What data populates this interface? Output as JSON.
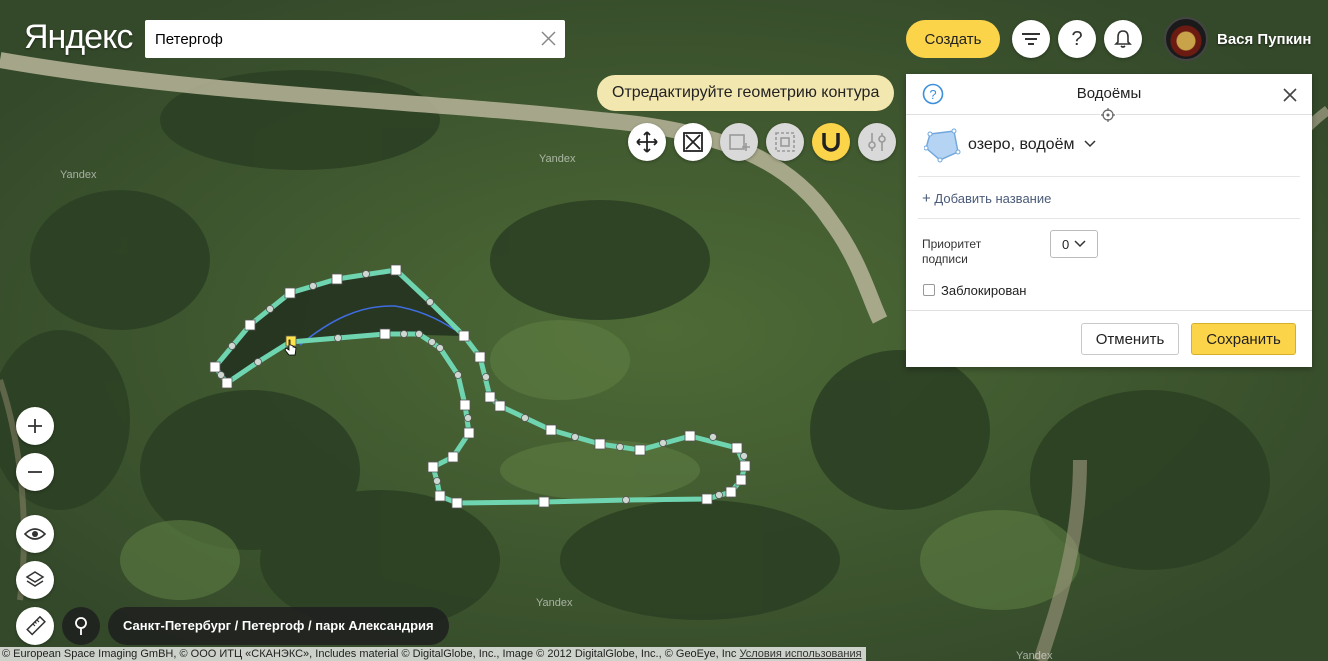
{
  "header": {
    "logo": "Яндекс",
    "search_value": "Петергоф",
    "create_label": "Создать",
    "user_name": "Вася Пупкин"
  },
  "icons": {
    "filter": "filter-icon",
    "help": "question-icon",
    "notifications": "bell-icon"
  },
  "editor": {
    "hint": "Отредактируйте геометрию контура",
    "tools": [
      {
        "name": "move-tool",
        "state": "enabled"
      },
      {
        "name": "delete-tool",
        "state": "enabled"
      },
      {
        "name": "add-contour-tool",
        "state": "disabled"
      },
      {
        "name": "cut-contour-tool",
        "state": "disabled"
      },
      {
        "name": "snap-magnet-tool",
        "state": "active"
      },
      {
        "name": "settings-tool",
        "state": "disabled"
      }
    ]
  },
  "panel": {
    "title": "Водоёмы",
    "type_label": "озеро, водоём",
    "add_name": "Добавить название",
    "priority_label": "Приоритет подписи",
    "priority_value": "0",
    "locked_label": "Заблокирован",
    "locked": false,
    "cancel_label": "Отменить",
    "save_label": "Сохранить"
  },
  "map": {
    "breadcrumb": "Санкт-Петербург / Петергоф / парк Александрия",
    "copyright": "© European Space Imaging GmBH, © ООО ИТЦ «СКАНЭКС», Includes material © DigitalGlobe, Inc., Image © 2012 DigitalGlobe, Inc., © GeoEye, Inc",
    "terms_link": "Условия использования",
    "watermark": "Yandex"
  },
  "colors": {
    "accent_yellow": "#fbd44a",
    "contour": "#6fd4b0",
    "hint_bg": "#f3e7b0"
  }
}
